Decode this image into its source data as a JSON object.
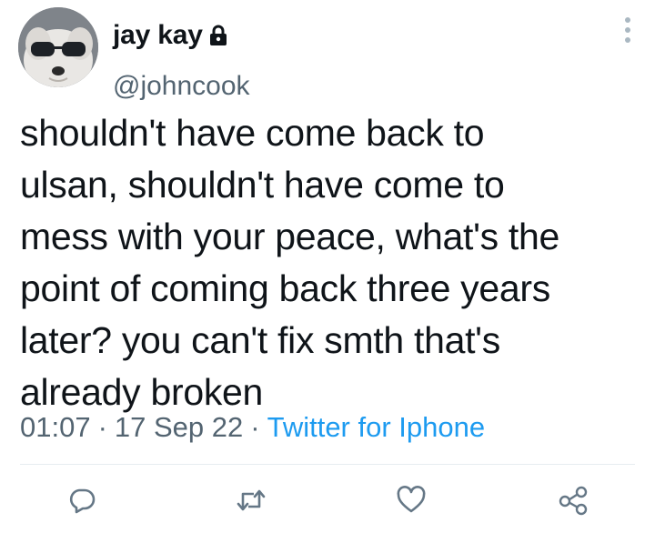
{
  "tweet": {
    "author": {
      "display_name": "jay kay",
      "handle": "@johncook",
      "protected_icon": "lock-icon",
      "avatar": "avatar"
    },
    "text": "shouldn't have come back to\nulsan, shouldn't have come to\nmess with your peace, what's the\npoint of coming back three years\nlater? you can't fix smth that's\nalready broken",
    "time": "01:07",
    "separator": "·",
    "date": "17 Sep 22",
    "client": "Twitter for Iphone"
  },
  "menu": {
    "icon": "more-vertical-icon"
  },
  "actions": [
    {
      "name": "reply",
      "icon": "reply-icon"
    },
    {
      "name": "retweet",
      "icon": "retweet-icon"
    },
    {
      "name": "like",
      "icon": "heart-icon"
    },
    {
      "name": "share",
      "icon": "share-icon"
    }
  ],
  "colors": {
    "text": "#0f1419",
    "secondary": "#536471",
    "link": "#1d9bf0",
    "divider": "#e6ecf0"
  }
}
